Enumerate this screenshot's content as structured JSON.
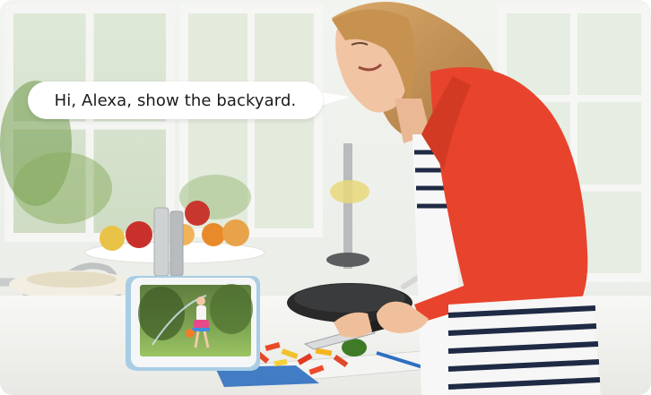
{
  "speech_bubble": {
    "text": "Hi, Alexa, show the backyard."
  },
  "device": {
    "name": "echo-show-5",
    "screen_content": "child-playing-with-sprinkler-in-backyard"
  },
  "colors": {
    "sweater": "#e8432c",
    "device_body": "#a9cde4",
    "knife_handle": "#2f6fc0",
    "window_frame": "#f4f4f2"
  }
}
